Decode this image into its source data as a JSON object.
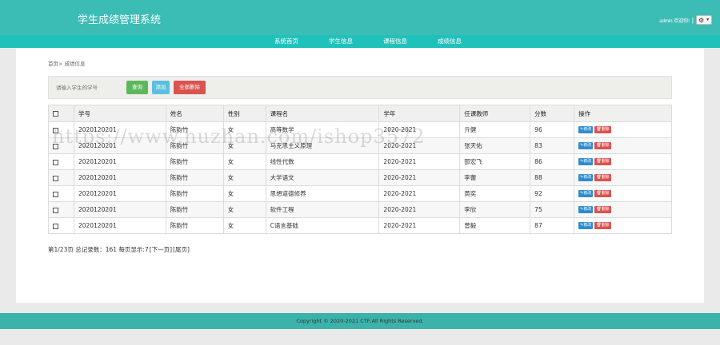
{
  "header": {
    "title": "学生成绩管理系统",
    "welcome": "admin 欢迎你!",
    "separator": "|",
    "settings_icon": "gear-icon"
  },
  "nav": {
    "items": [
      "系统首页",
      "学生信息",
      "课程信息",
      "成绩信息"
    ]
  },
  "breadcrumb": "首页> 成绩信息",
  "toolbar": {
    "search_placeholder": "请输入学生的学号",
    "search_label": "查询",
    "add_label": "添加",
    "delete_label": "全部删除"
  },
  "table": {
    "columns": [
      "学号",
      "姓名",
      "性别",
      "课程名",
      "学年",
      "任课教师",
      "分数",
      "操作"
    ],
    "rows": [
      [
        "2020120201",
        "陈韵竹",
        "女",
        "高等数学",
        "2020-2021",
        "亓健",
        "96"
      ],
      [
        "2020120201",
        "陈韵竹",
        "女",
        "马克思主义原理",
        "2020-2021",
        "张天佑",
        "83"
      ],
      [
        "2020120201",
        "陈韵竹",
        "女",
        "线性代数",
        "2020-2021",
        "邵宏飞",
        "86"
      ],
      [
        "2020120201",
        "陈韵竹",
        "女",
        "大学语文",
        "2020-2021",
        "李蕾",
        "88"
      ],
      [
        "2020120201",
        "陈韵竹",
        "女",
        "思想道德修养",
        "2020-2021",
        "黄奕",
        "92"
      ],
      [
        "2020120201",
        "陈韵竹",
        "女",
        "软件工程",
        "2020-2021",
        "李欣",
        "75"
      ],
      [
        "2020120201",
        "陈韵竹",
        "女",
        "C语言基础",
        "2020-2021",
        "曾毅",
        "87"
      ]
    ],
    "edit_label": "修改",
    "delete_label": "删除"
  },
  "pagination": {
    "summary": "第1/23页 总记录数：161 每页显示:7",
    "next": "[下一页]",
    "last": "[尾页]"
  },
  "watermark": "https://www.huzhan.com/ishop3572",
  "footer": "Copyright © 2020-2021 CTF,All Rights Reserved."
}
